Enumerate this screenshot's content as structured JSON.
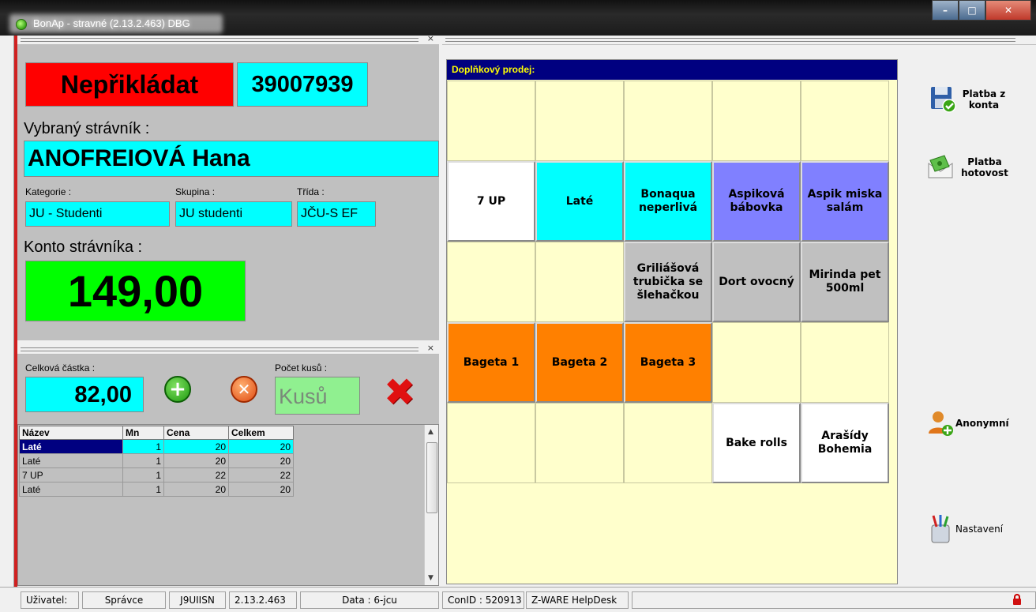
{
  "window": {
    "title": "BonAp - stravné (2.13.2.463) DBG",
    "controls": {
      "minimize": "–",
      "maximize": "□",
      "close": "✕"
    }
  },
  "customer": {
    "status": "Nepřikládat",
    "card_number": "39007939",
    "selected_label": "Vybraný strávník :",
    "name": "ANOFREIOVÁ Hana",
    "category_label": "Kategorie :",
    "category": "JU - Studenti",
    "group_label": "Skupina :",
    "group": "JU studenti",
    "class_label": "Třída :",
    "class": "JČU-S EF",
    "account_label": "Konto strávníka :",
    "account_balance": "149,00"
  },
  "order": {
    "total_label": "Celková částka :",
    "total": "82,00",
    "count_label": "Počet kusů :",
    "count_placeholder": "Kusů"
  },
  "items_table": {
    "columns": [
      "Název",
      "Mn",
      "Cena",
      "Celkem"
    ],
    "rows": [
      {
        "name": "Laté",
        "qty": "1",
        "price": "20",
        "total": "20",
        "selected": true
      },
      {
        "name": "Laté",
        "qty": "1",
        "price": "20",
        "total": "20",
        "selected": false
      },
      {
        "name": "7 UP",
        "qty": "1",
        "price": "22",
        "total": "22",
        "selected": false
      },
      {
        "name": "Laté",
        "qty": "1",
        "price": "20",
        "total": "20",
        "selected": false
      }
    ]
  },
  "sales_panel": {
    "header": "Doplňkový prodej:",
    "rows": [
      [
        {
          "label": "",
          "color": ""
        },
        {
          "label": "",
          "color": ""
        },
        {
          "label": "",
          "color": ""
        },
        {
          "label": "",
          "color": ""
        },
        {
          "label": "",
          "color": ""
        }
      ],
      [
        {
          "label": "7 UP",
          "color": "#ffffff"
        },
        {
          "label": "Laté",
          "color": "#00ffff"
        },
        {
          "label": "Bonaqua neperlivá",
          "color": "#00ffff"
        },
        {
          "label": "Aspiková bábovka",
          "color": "#8080ff"
        },
        {
          "label": "Aspik miska salám",
          "color": "#8080ff"
        }
      ],
      [
        {
          "label": "",
          "color": ""
        },
        {
          "label": "",
          "color": ""
        },
        {
          "label": "Griliášová trubička se šlehačkou",
          "color": "#c0c0c0"
        },
        {
          "label": "Dort ovocný",
          "color": "#c0c0c0"
        },
        {
          "label": "Mirinda pet 500ml",
          "color": "#c0c0c0"
        }
      ],
      [
        {
          "label": "Bageta 1",
          "color": "#ff8000"
        },
        {
          "label": "Bageta 2",
          "color": "#ff8000"
        },
        {
          "label": "Bageta 3",
          "color": "#ff8000"
        },
        {
          "label": "",
          "color": ""
        },
        {
          "label": "",
          "color": ""
        }
      ],
      [
        {
          "label": "",
          "color": ""
        },
        {
          "label": "",
          "color": ""
        },
        {
          "label": "",
          "color": ""
        },
        {
          "label": "Bake rolls",
          "color": "#ffffff"
        },
        {
          "label": "Arašídy Bohemia",
          "color": "#ffffff"
        }
      ]
    ]
  },
  "actions": {
    "pay_account": "Platba z konta",
    "pay_cash": "Platba hotovost",
    "anonymous": "Anonymní",
    "settings": "Nastavení"
  },
  "status_bar": {
    "user_label": "Uživatel:",
    "user": "Správce",
    "station": "J9UIISN",
    "version": "2.13.2.463",
    "data": "Data : 6-jcu",
    "con_id": "ConID : 520913",
    "helpdesk": "Z-WARE HelpDesk"
  },
  "colors": {
    "status_red": "#ff0000",
    "info_cyan": "#00ffff",
    "balance_green": "#00ff00",
    "sale_bg": "#ffffcc",
    "header_navy": "#000080"
  }
}
